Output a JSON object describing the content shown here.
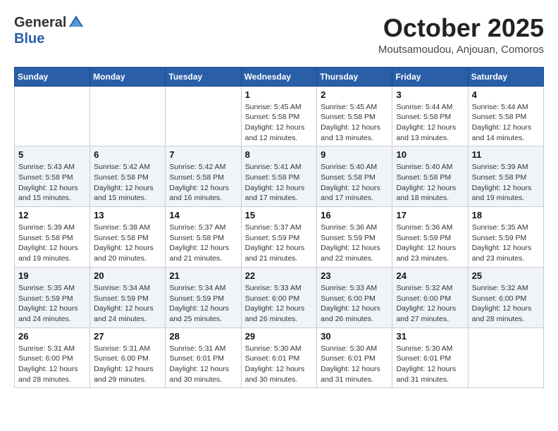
{
  "header": {
    "logo_general": "General",
    "logo_blue": "Blue",
    "month_title": "October 2025",
    "location": "Moutsamoudou, Anjouan, Comoros"
  },
  "days_of_week": [
    "Sunday",
    "Monday",
    "Tuesday",
    "Wednesday",
    "Thursday",
    "Friday",
    "Saturday"
  ],
  "weeks": [
    [
      {
        "day": "",
        "info": ""
      },
      {
        "day": "",
        "info": ""
      },
      {
        "day": "",
        "info": ""
      },
      {
        "day": "1",
        "info": "Sunrise: 5:45 AM\nSunset: 5:58 PM\nDaylight: 12 hours\nand 12 minutes."
      },
      {
        "day": "2",
        "info": "Sunrise: 5:45 AM\nSunset: 5:58 PM\nDaylight: 12 hours\nand 13 minutes."
      },
      {
        "day": "3",
        "info": "Sunrise: 5:44 AM\nSunset: 5:58 PM\nDaylight: 12 hours\nand 13 minutes."
      },
      {
        "day": "4",
        "info": "Sunrise: 5:44 AM\nSunset: 5:58 PM\nDaylight: 12 hours\nand 14 minutes."
      }
    ],
    [
      {
        "day": "5",
        "info": "Sunrise: 5:43 AM\nSunset: 5:58 PM\nDaylight: 12 hours\nand 15 minutes."
      },
      {
        "day": "6",
        "info": "Sunrise: 5:42 AM\nSunset: 5:58 PM\nDaylight: 12 hours\nand 15 minutes."
      },
      {
        "day": "7",
        "info": "Sunrise: 5:42 AM\nSunset: 5:58 PM\nDaylight: 12 hours\nand 16 minutes."
      },
      {
        "day": "8",
        "info": "Sunrise: 5:41 AM\nSunset: 5:58 PM\nDaylight: 12 hours\nand 17 minutes."
      },
      {
        "day": "9",
        "info": "Sunrise: 5:40 AM\nSunset: 5:58 PM\nDaylight: 12 hours\nand 17 minutes."
      },
      {
        "day": "10",
        "info": "Sunrise: 5:40 AM\nSunset: 5:58 PM\nDaylight: 12 hours\nand 18 minutes."
      },
      {
        "day": "11",
        "info": "Sunrise: 5:39 AM\nSunset: 5:58 PM\nDaylight: 12 hours\nand 19 minutes."
      }
    ],
    [
      {
        "day": "12",
        "info": "Sunrise: 5:39 AM\nSunset: 5:58 PM\nDaylight: 12 hours\nand 19 minutes."
      },
      {
        "day": "13",
        "info": "Sunrise: 5:38 AM\nSunset: 5:58 PM\nDaylight: 12 hours\nand 20 minutes."
      },
      {
        "day": "14",
        "info": "Sunrise: 5:37 AM\nSunset: 5:58 PM\nDaylight: 12 hours\nand 21 minutes."
      },
      {
        "day": "15",
        "info": "Sunrise: 5:37 AM\nSunset: 5:59 PM\nDaylight: 12 hours\nand 21 minutes."
      },
      {
        "day": "16",
        "info": "Sunrise: 5:36 AM\nSunset: 5:59 PM\nDaylight: 12 hours\nand 22 minutes."
      },
      {
        "day": "17",
        "info": "Sunrise: 5:36 AM\nSunset: 5:59 PM\nDaylight: 12 hours\nand 23 minutes."
      },
      {
        "day": "18",
        "info": "Sunrise: 5:35 AM\nSunset: 5:59 PM\nDaylight: 12 hours\nand 23 minutes."
      }
    ],
    [
      {
        "day": "19",
        "info": "Sunrise: 5:35 AM\nSunset: 5:59 PM\nDaylight: 12 hours\nand 24 minutes."
      },
      {
        "day": "20",
        "info": "Sunrise: 5:34 AM\nSunset: 5:59 PM\nDaylight: 12 hours\nand 24 minutes."
      },
      {
        "day": "21",
        "info": "Sunrise: 5:34 AM\nSunset: 5:59 PM\nDaylight: 12 hours\nand 25 minutes."
      },
      {
        "day": "22",
        "info": "Sunrise: 5:33 AM\nSunset: 6:00 PM\nDaylight: 12 hours\nand 26 minutes."
      },
      {
        "day": "23",
        "info": "Sunrise: 5:33 AM\nSunset: 6:00 PM\nDaylight: 12 hours\nand 26 minutes."
      },
      {
        "day": "24",
        "info": "Sunrise: 5:32 AM\nSunset: 6:00 PM\nDaylight: 12 hours\nand 27 minutes."
      },
      {
        "day": "25",
        "info": "Sunrise: 5:32 AM\nSunset: 6:00 PM\nDaylight: 12 hours\nand 28 minutes."
      }
    ],
    [
      {
        "day": "26",
        "info": "Sunrise: 5:31 AM\nSunset: 6:00 PM\nDaylight: 12 hours\nand 28 minutes."
      },
      {
        "day": "27",
        "info": "Sunrise: 5:31 AM\nSunset: 6:00 PM\nDaylight: 12 hours\nand 29 minutes."
      },
      {
        "day": "28",
        "info": "Sunrise: 5:31 AM\nSunset: 6:01 PM\nDaylight: 12 hours\nand 30 minutes."
      },
      {
        "day": "29",
        "info": "Sunrise: 5:30 AM\nSunset: 6:01 PM\nDaylight: 12 hours\nand 30 minutes."
      },
      {
        "day": "30",
        "info": "Sunrise: 5:30 AM\nSunset: 6:01 PM\nDaylight: 12 hours\nand 31 minutes."
      },
      {
        "day": "31",
        "info": "Sunrise: 5:30 AM\nSunset: 6:01 PM\nDaylight: 12 hours\nand 31 minutes."
      },
      {
        "day": "",
        "info": ""
      }
    ]
  ]
}
